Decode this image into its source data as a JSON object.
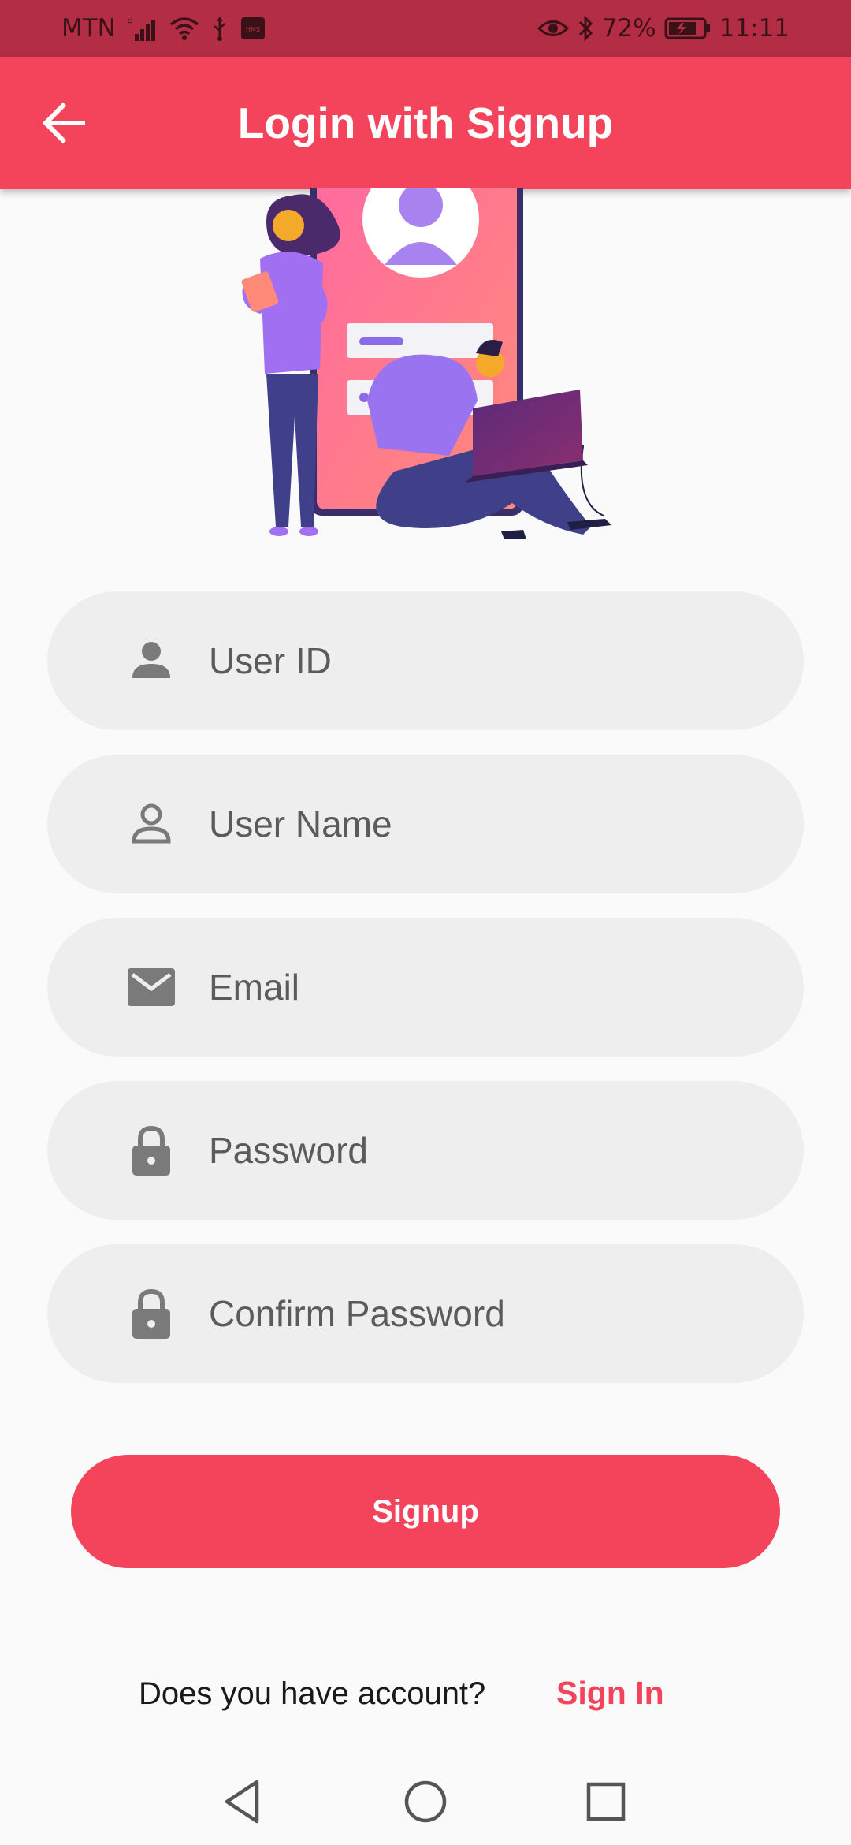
{
  "status_bar": {
    "carrier": "MTN",
    "battery_percent": "72%",
    "time": "11:11",
    "icons": [
      "signal-icon",
      "wifi-icon",
      "usb-icon",
      "hms-icon",
      "eye-icon",
      "bluetooth-icon",
      "battery-icon"
    ]
  },
  "app_bar": {
    "title": "Login with Signup",
    "back_icon": "arrow-left-icon"
  },
  "form": {
    "fields": [
      {
        "placeholder": "User ID",
        "icon": "person-filled-icon"
      },
      {
        "placeholder": "User Name",
        "icon": "person-outline-icon"
      },
      {
        "placeholder": "Email",
        "icon": "mail-icon"
      },
      {
        "placeholder": "Password",
        "icon": "lock-icon"
      },
      {
        "placeholder": "Confirm Password",
        "icon": "lock-icon"
      }
    ],
    "submit_label": "Signup"
  },
  "footer": {
    "question": "Does you have account?",
    "link": "Sign In"
  },
  "colors": {
    "primary": "#f4445c",
    "status_bar": "#b32d44",
    "field_bg": "#eeeeee",
    "icon_gray": "#7a7a7a"
  },
  "nav_bar": {
    "icons": [
      "back-triangle-icon",
      "home-circle-icon",
      "recents-square-icon"
    ]
  }
}
